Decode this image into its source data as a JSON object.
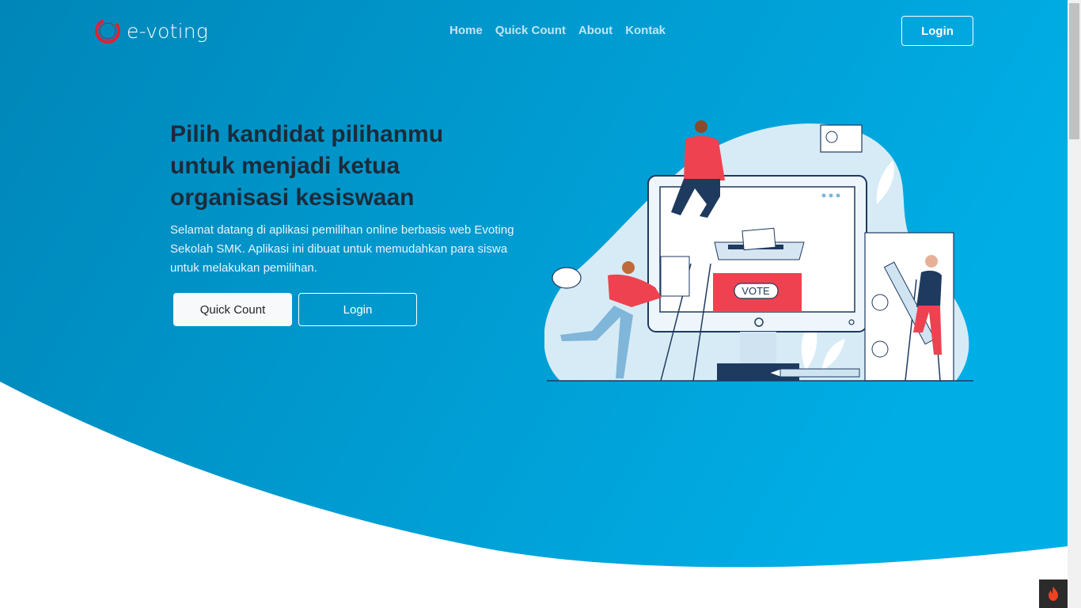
{
  "brand": {
    "name": "e-voting",
    "logo_icon": "ring-logo-icon"
  },
  "nav": {
    "links": [
      "Home",
      "Quick Count",
      "About",
      "Kontak"
    ],
    "login_label": "Login"
  },
  "hero": {
    "title": "Pilih kandidat pilihanmu untuk menjadi ketua organisasi kesiswaan",
    "subtitle": "Selamat datang di aplikasi pemilihan online berbasis web Evoting Sekolah SMK. Aplikasi ini dibuat untuk memudahkan para siswa untuk melakukan pemilihan.",
    "quick_count_label": "Quick Count",
    "login_label": "Login",
    "illustration": {
      "ballot_label": "VOTE"
    }
  },
  "colors": {
    "gradient_start": "#0086b8",
    "gradient_end": "#00aee6",
    "accent_red": "#ef4250",
    "headline": "#1c2b3a"
  },
  "dev_badge_icon": "flame-icon"
}
